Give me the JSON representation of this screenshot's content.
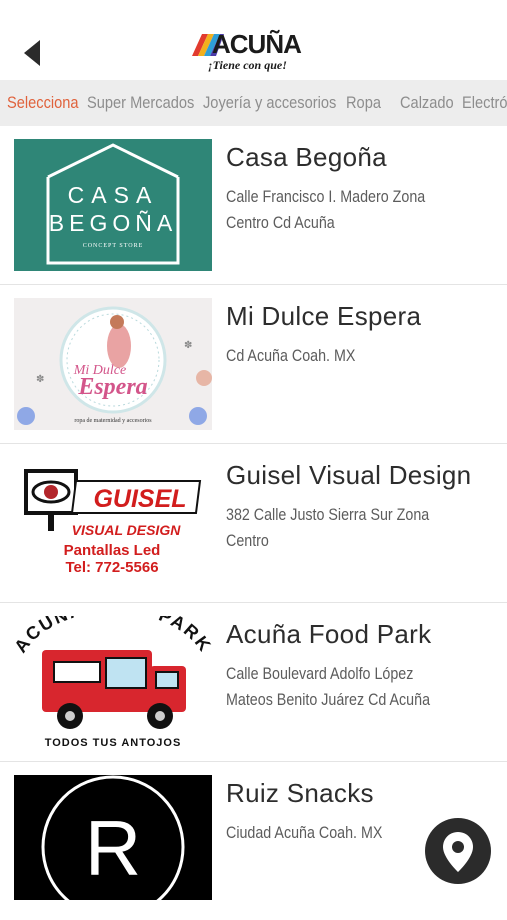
{
  "header": {
    "logo_text": "ACUÑA",
    "tagline": "¡Tiene con que!"
  },
  "categories": [
    {
      "label": "Selecciona",
      "active": true
    },
    {
      "label": "Super Mercados",
      "active": false
    },
    {
      "label": "Joyería y accesorios",
      "active": false
    },
    {
      "label": "Ropa",
      "active": false
    },
    {
      "label": "Calzado",
      "active": false
    },
    {
      "label": "Electrónica",
      "active": false
    }
  ],
  "listings": [
    {
      "name": "Casa Begoña",
      "address": "Calle Francisco I. Madero Zona Centro Cd Acuña",
      "thumb": {
        "line1": "CASA",
        "line2": "BEGOÑA",
        "line3": "CONCEPT STORE",
        "bg": "#2f8677"
      }
    },
    {
      "name": "Mi Dulce Espera",
      "address": "Cd Acuña Coah. MX",
      "thumb": {
        "line1": "Mi Dulce",
        "line2": "Espera",
        "line3": "ropa de maternidad y accesorios"
      }
    },
    {
      "name": "Guisel Visual Design",
      "address": "382 Calle Justo Sierra Sur Zona Centro",
      "thumb": {
        "line1": "GUISEL",
        "line2": "VISUAL DESIGN",
        "line3": "Pantallas Led",
        "line4": "Tel: 772-5566"
      }
    },
    {
      "name": "Acuña Food Park",
      "address": "Calle Boulevard Adolfo López Mateos Benito Juárez Cd Acuña",
      "thumb": {
        "line1": "ACUÑA FOOD PARK",
        "line2": "TODOS TUS ANTOJOS"
      }
    },
    {
      "name": "Ruiz Snacks",
      "address": "Ciudad Acuña Coah. MX",
      "thumb": {
        "line1": "R"
      }
    }
  ],
  "colors": {
    "accent": "#e0623c",
    "category_bg": "#ededed",
    "fab": "#2b2b2b"
  },
  "icons": {
    "back": "back-arrow-icon",
    "map": "map-pin-icon"
  }
}
